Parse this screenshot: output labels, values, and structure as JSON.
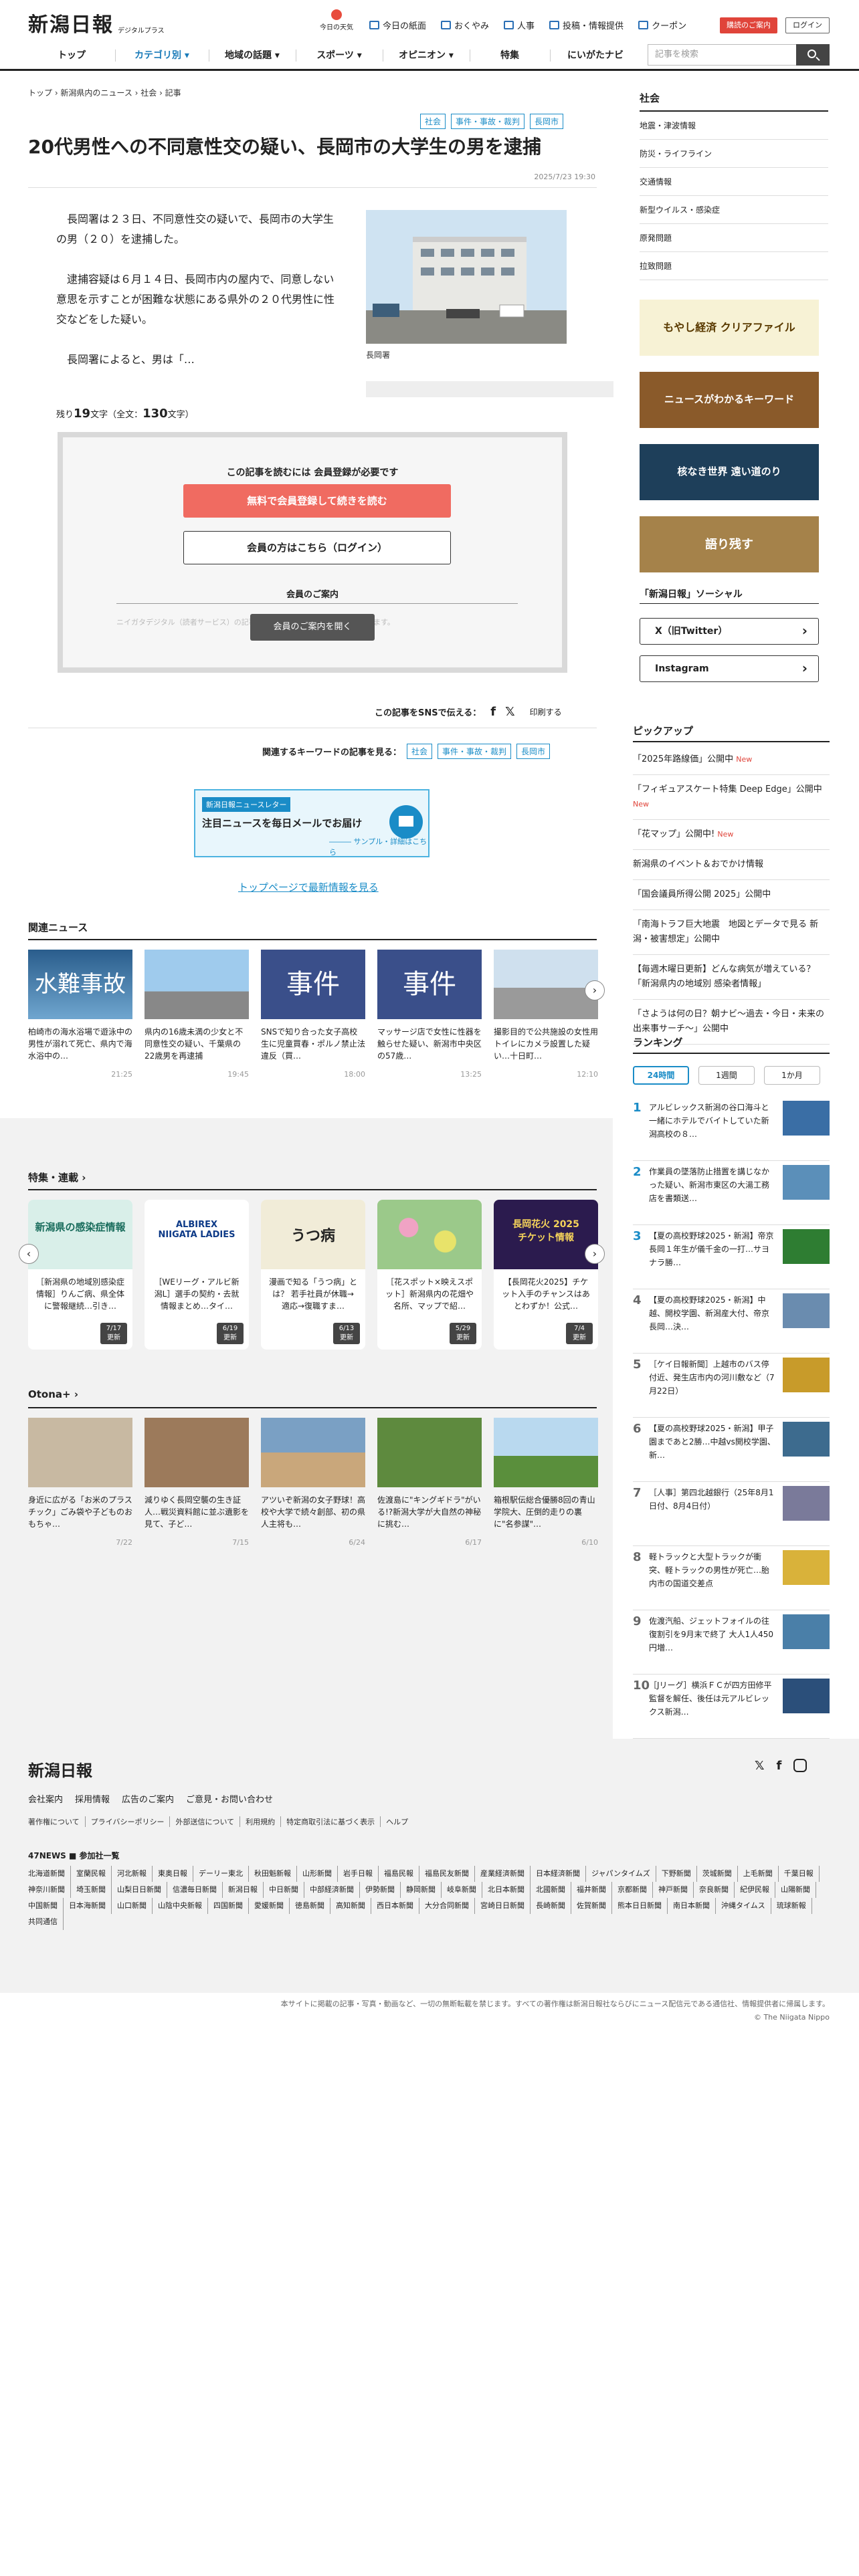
{
  "header": {
    "logo": "新潟日報",
    "logo_sub": "デジタルプラス",
    "weather": "今日の天気",
    "links": [
      "今日の紙面",
      "おくやみ",
      "人事",
      "投稿・情報提供",
      "クーポン"
    ],
    "member_btn": "購読のご案内",
    "login_btn": "ログイン",
    "search_placeholder": "記事を検索"
  },
  "nav": [
    "トップ",
    "カテゴリ別 ▾",
    "地域の話題 ▾",
    "スポーツ ▾",
    "オピニオン ▾",
    "特集",
    "にいがたナビ"
  ],
  "breadcrumb": "トップ › 新潟県内のニュース › 社会 › 記事",
  "article": {
    "tags": [
      "社会",
      "事件・事故・裁判",
      "長岡市"
    ],
    "title": "20代男性への不同意性交の疑い、長岡市の大学生の男を逮捕",
    "date": "2025/7/23 19:30",
    "paragraphs": [
      "長岡署は２３日、不同意性交の疑いで、長岡市の大学生の男（２０）を逮捕した。",
      "逮捕容疑は６月１４日、長岡市内の屋内で、同意しない意思を示すことが困難な状態にある県外の２０代男性に性交などをした疑い。",
      "長岡署によると、男は「…"
    ],
    "photo_caption": "長岡署",
    "remain_prefix": "残り",
    "remain_num": "19",
    "remain_mid": "文字（全文：",
    "total_num": "130",
    "remain_suffix": "文字）"
  },
  "paywall": {
    "lead": "この記事を読むには 会員登録が必要です",
    "register": "無料で会員登録して続きを読む",
    "login": "会員の方はこちら（ログイン）",
    "guide_title": "会員のご案内",
    "ghost": "ニイガタデジタル（読者サービス）の記事を全てのデバイスで、閲覧いただけます。",
    "guide_btn": "会員のご案内を開く"
  },
  "share": {
    "label": "この記事をSNSで伝える：",
    "print": "印刷する"
  },
  "keywords": {
    "label": "関連するキーワードの記事を見る：",
    "items": [
      "社会",
      "事件・事故・裁判",
      "長岡市"
    ]
  },
  "newsletter": {
    "badge": "新潟日報ニュースレター",
    "title": "注目ニュースを毎日メールでお届け",
    "sub": "――― サンプル・詳細はこちら"
  },
  "toplink": "トップページで最新情報を見る",
  "related": {
    "title": "関連ニュース",
    "items": [
      {
        "img": "水難事故",
        "text": "柏崎市の海水浴場で遊泳中の男性が溺れて死亡、県内で海水浴中の…",
        "time": "21:25"
      },
      {
        "img": "",
        "text": "県内の16歳未満の少女と不同意性交の疑い、千葉県の22歳男を再逮捕",
        "time": "19:45"
      },
      {
        "img": "事件",
        "text": "SNSで知り合った女子高校生に児童買春・ポルノ禁止法違反（買…",
        "time": "18:00"
      },
      {
        "img": "事件",
        "text": "マッサージ店で女性に性器を触らせた疑い、新潟市中央区の57歳…",
        "time": "13:25"
      },
      {
        "img": "",
        "text": "撮影目的で公共施設の女性用トイレにカメラ設置した疑い…十日町…",
        "time": "12:10"
      }
    ]
  },
  "features": {
    "title": "特集・連載 ›",
    "items": [
      {
        "img": "新潟県の感染症情報",
        "text": "［新潟県の地域別感染症情報］りんご病、県全体に警報継続…引き…",
        "date": "7/17",
        "upd": "更新"
      },
      {
        "img": "ALBIREX NIIGATA LADIES",
        "text": "［WEリーグ・アルビ新潟L］選手の契約・去就情報まとめ…タイ…",
        "date": "6/19",
        "upd": "更新"
      },
      {
        "img": "うつ病",
        "text": "漫画で知る「うつ病」とは？ 若手社員が休職→適応→復職すま…",
        "date": "6/13",
        "upd": "更新"
      },
      {
        "img": "",
        "text": "［花スポット×映えスポット］新潟県内の花畑や名所、マップで紹…",
        "date": "5/29",
        "upd": "更新"
      },
      {
        "img": "長岡花火 2025 チケット情報",
        "text": "【長岡花火2025】チケット入手のチャンスはあとわずか！公式…",
        "date": "7/4",
        "upd": "更新"
      }
    ]
  },
  "otona": {
    "title": "Otona+ ›",
    "items": [
      {
        "text": "身近に広がる「お米のプラスチック」ごみ袋や子どものおもちゃ…",
        "date": "7/22"
      },
      {
        "text": "減りゆく長岡空襲の生き証人…戦災資料館に並ぶ遺影を見て、子ど…",
        "date": "7/15"
      },
      {
        "text": "アツいぞ新潟の女子野球！高校や大学で続々創部、初の県人主将も…",
        "date": "6/24"
      },
      {
        "text": "佐渡島に\"キングギドラ\"がいる!?新潟大学が大自然の神秘に挑む…",
        "date": "6/17"
      },
      {
        "text": "箱根駅伝総合優勝8回の青山学院大、圧倒的走りの裏に\"名参謀\"…",
        "date": "6/10"
      }
    ]
  },
  "sidebar": {
    "section": "社会",
    "items": [
      "地震・津波情報",
      "防災・ライフライン",
      "交通情報",
      "新型ウイルス・感染症",
      "原発問題",
      "拉致問題"
    ],
    "banners": [
      "もやし経済 クリアファイル",
      "ニュースがわかるキーワード",
      "核なき世界 遠い道のり",
      "語り残す"
    ],
    "social_title": "「新潟日報」ソーシャル",
    "social": [
      "X（旧Twitter）",
      "Instagram"
    ],
    "pickup_title": "ピックアップ",
    "pickup": [
      {
        "t": "「2025年路線価」公開中",
        "n": "New"
      },
      {
        "t": "「フィギュアスケート特集 Deep Edge」公開中",
        "n": "New"
      },
      {
        "t": "「花マップ」公開中!",
        "n": "New"
      },
      {
        "t": "新潟県のイベント＆おでかけ情報",
        "n": ""
      },
      {
        "t": "「国会議員所得公開 2025」公開中",
        "n": ""
      },
      {
        "t": "「南海トラフ巨大地震　地図とデータで見る 新潟・被害想定」公開中",
        "n": ""
      },
      {
        "t": "【毎週木曜日更新】どんな病気が増えている？「新潟県内の地域別 感染者情報」",
        "n": ""
      },
      {
        "t": "「さようは何の日？朝ナビ～過去・今日・未来の出来事サーチ～」公開中",
        "n": ""
      }
    ],
    "ranking_title": "ランキング",
    "rank_tabs": [
      "24時間",
      "1週間",
      "1か月"
    ],
    "ranking": [
      "アルビレックス新潟の谷口海斗と一緒にホテルでバイトしていた新潟高校の８…",
      "作業員の墜落防止措置を講じなかった疑い、新潟市東区の大湯工務店を書類送…",
      "【夏の高校野球2025・新潟】帝京長岡１年生が儀千金の一打…サヨナラ勝…",
      "【夏の高校野球2025・新潟】中越、開校学園、新潟産大付、帝京長岡…決…",
      "［ケイ日報新聞］上越市のバス停付近、発生店市内の河川敷など（7月22日）",
      "【夏の高校野球2025・新潟】甲子園まであと2勝…中越vs開校学園、新…",
      "［人事］第四北越銀行（25年8月1日付、8月4日付）",
      "軽トラックと大型トラックが衝突、軽トラックの男性が死亡…胎内市の国道交差点",
      "佐渡汽船、ジェットフォイルの往復割引を9月末で終了 大人1人450円増…",
      "［Jリーグ］横浜ＦＣが四方田修平監督を解任、後任は元アルビレックス新潟…"
    ]
  },
  "footer": {
    "logo": "新潟日報",
    "links1": [
      "会社案内",
      "採用情報",
      "広告のご案内",
      "ご意見・お問い合わせ"
    ],
    "links2": [
      "著作権について",
      "プライバシーポリシー",
      "外部送信について",
      "利用規約",
      "特定商取引法に基づく表示",
      "ヘルプ"
    ],
    "h47": "47NEWS ■ 参加社一覧",
    "papers": [
      "北海道新聞",
      "室蘭民報",
      "河北新報",
      "東奥日報",
      "デーリー東北",
      "秋田魁新報",
      "山形新聞",
      "岩手日報",
      "福島民報",
      "福島民友新聞",
      "産業経済新聞",
      "日本経済新聞",
      "ジャパンタイムズ",
      "下野新聞",
      "茨城新聞",
      "上毛新聞",
      "千葉日報",
      "神奈川新聞",
      "埼玉新聞",
      "山梨日日新聞",
      "信濃毎日新聞",
      "新潟日報",
      "中日新聞",
      "中部経済新聞",
      "伊勢新聞",
      "静岡新聞",
      "岐阜新聞",
      "北日本新聞",
      "北國新聞",
      "福井新聞",
      "京都新聞",
      "神戸新聞",
      "奈良新聞",
      "紀伊民報",
      "山陽新聞",
      "中国新聞",
      "日本海新聞",
      "山口新聞",
      "山陰中央新報",
      "四国新聞",
      "愛媛新聞",
      "徳島新聞",
      "高知新聞",
      "西日本新聞",
      "大分合同新聞",
      "宮崎日日新聞",
      "長崎新聞",
      "佐賀新聞",
      "熊本日日新聞",
      "南日本新聞",
      "沖縄タイムス",
      "琉球新報",
      "共同通信"
    ],
    "copy": "本サイトに掲載の記事・写真・動画など、一切の無断転載を禁じます。すべての著作権は新潟日報社ならびにニュース配信元である通信社、情報提供者に帰属します。",
    "copy2": "© The Niigata Nippo"
  }
}
